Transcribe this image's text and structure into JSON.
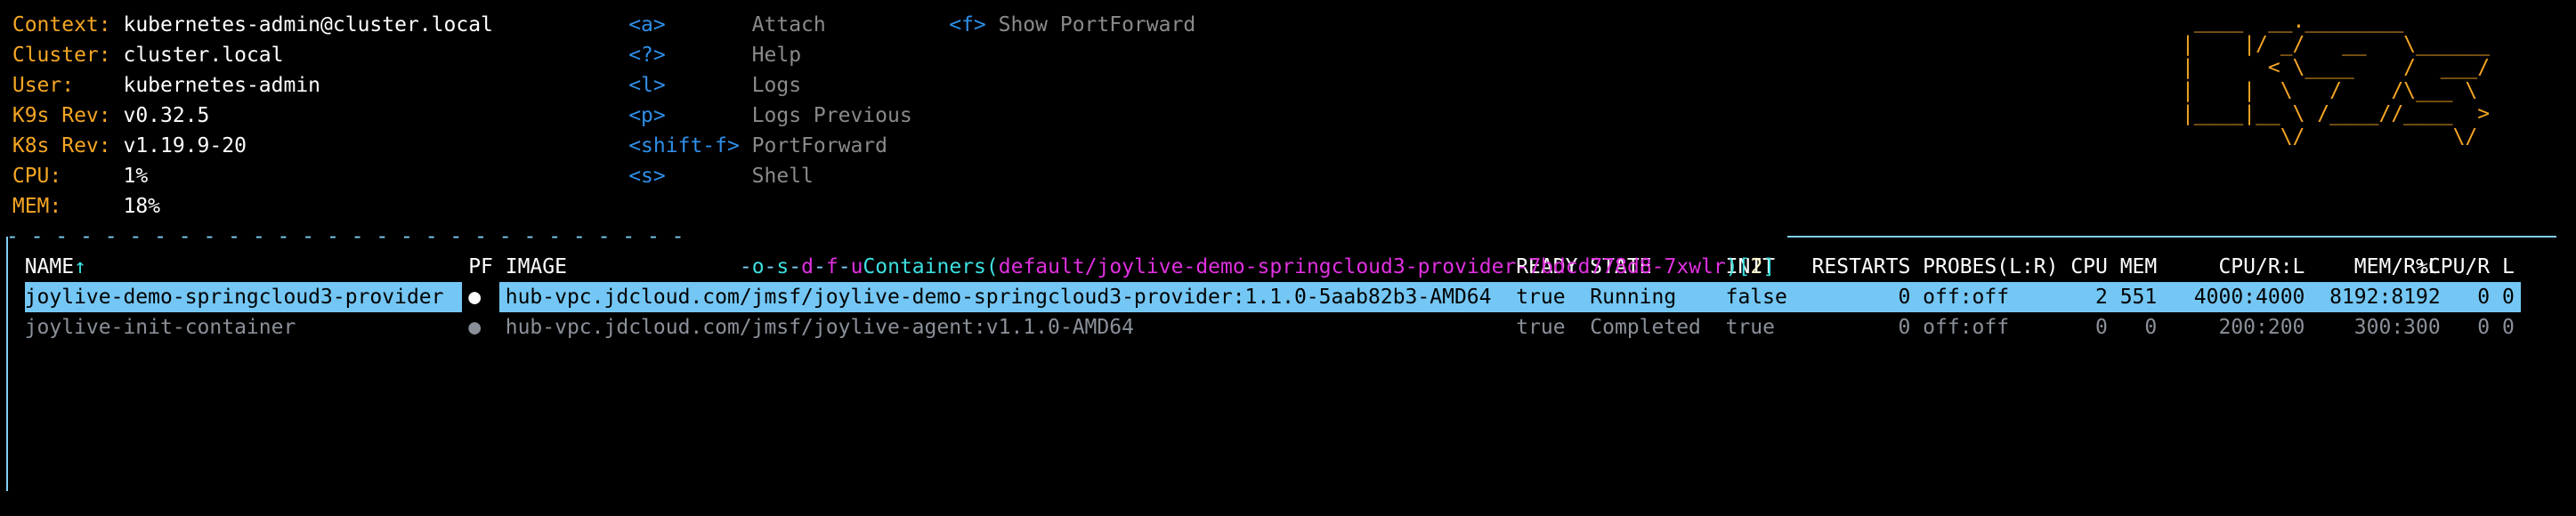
{
  "info": [
    {
      "label": "Context:",
      "value": "kubernetes-admin@cluster.local"
    },
    {
      "label": "Cluster:",
      "value": "cluster.local"
    },
    {
      "label": "User:",
      "value": "kubernetes-admin"
    },
    {
      "label": "K9s Rev:",
      "value": "v0.32.5"
    },
    {
      "label": "K8s Rev:",
      "value": "v1.19.9-20"
    },
    {
      "label": "CPU:",
      "value": "1%"
    },
    {
      "label": "MEM:",
      "value": "18%"
    }
  ],
  "shortcuts": [
    {
      "key": "<a>",
      "action": "Attach"
    },
    {
      "key": "<?>",
      "action": "Help"
    },
    {
      "key": "<l>",
      "action": "Logs"
    },
    {
      "key": "<p>",
      "action": "Logs Previous"
    },
    {
      "key": "<shift-f>",
      "action": "PortForward"
    },
    {
      "key": "<s>",
      "action": "Shell"
    }
  ],
  "shortcuts2": [
    {
      "key": "<f>",
      "action": "Show PortForward"
    }
  ],
  "logo": " ____  __.________       \n|    |/ _/   __   \\______\n|      < \\____    /  ___/\n|    |  \\   /    /\\___ \\ \n|____|__ \\ /____//____  >\n        \\/            \\/ ",
  "title": {
    "dashes": "- - - - - - - - - - - - - - - - - - - - - - - - - - - -",
    "crumbs": [
      "o",
      "s",
      "d",
      "f",
      "u"
    ],
    "resource": "Containers",
    "path": "default/joylive-demo-springcloud3-provider-7bdcd778d8-7xwlr",
    "count": "2"
  },
  "table": {
    "sort_indicator": "↑",
    "headers": [
      "NAME",
      "PF",
      "IMAGE",
      "READY",
      "STATE",
      "INIT",
      "RESTARTS",
      "PROBES(L:R)",
      "CPU",
      "MEM",
      "CPU/R:L",
      "MEM/R:L",
      "%CPU/R",
      "L"
    ],
    "rows": [
      [
        "joylive-demo-springcloud3-provider",
        "●",
        "hub-vpc.jdcloud.com/jmsf/joylive-demo-springcloud3-provider:1.1.0-5aab82b3-AMD64",
        "true",
        "Running",
        "false",
        "0",
        "off:off",
        "2",
        "551",
        "4000:4000",
        "8192:8192",
        "0",
        "0"
      ],
      [
        "joylive-init-container",
        "●",
        "hub-vpc.jdcloud.com/jmsf/joylive-agent:v1.1.0-AMD64",
        "true",
        "Completed",
        "true",
        "0",
        "off:off",
        "0",
        "0",
        "200:200",
        "300:300",
        "0",
        "0"
      ]
    ],
    "selected_row": 0
  },
  "colors": {
    "label": "#f5a623",
    "key": "#2f8fe8",
    "highlight": "#74c7f4",
    "border": "#7fcff5",
    "title": "#3ce0e0",
    "path": "#e030e0"
  }
}
